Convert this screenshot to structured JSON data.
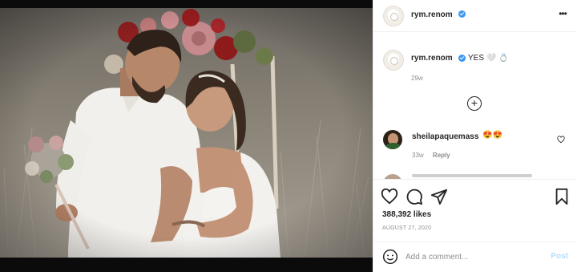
{
  "post": {
    "image_alt": "",
    "likes": "388,392 likes",
    "date": "AUGUST 27, 2020"
  },
  "header": {
    "username": "rym.renom",
    "verified": true,
    "more_icon": "more-options-icon"
  },
  "caption": {
    "username": "rym.renom",
    "text": "YES 🤍 💍",
    "time": "29w"
  },
  "load_more_icon": "plus-circle-icon",
  "comments": [
    {
      "username": "sheilapaquemass",
      "text": "😍😍",
      "time": "33w",
      "reply_label": "Reply",
      "like_icon": "heart-outline-icon"
    }
  ],
  "actions": {
    "like_icon": "heart-icon",
    "comment_icon": "comment-icon",
    "share_icon": "send-icon",
    "save_icon": "bookmark-icon"
  },
  "add_comment": {
    "placeholder": "Add a comment...",
    "post_label": "Post",
    "emoji_icon": "smile-icon"
  },
  "colors": {
    "verified": "#3897f0",
    "post_button_disabled": "#b2dffc",
    "secondary_text": "#8e8e8e",
    "primary_text": "#262626"
  }
}
